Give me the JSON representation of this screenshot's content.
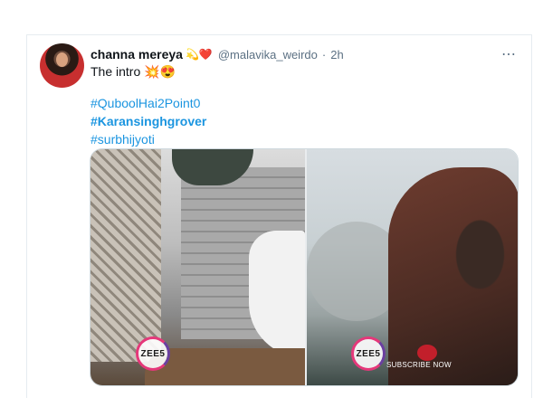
{
  "tweet": {
    "display_name": "channa mereya",
    "name_emojis": "💫❤️",
    "handle": "@malavika_weirdo",
    "separator": "·",
    "time": "2h",
    "more_icon": "⋯",
    "text": "The intro 💥😍",
    "hashtags": [
      "#QuboolHai2Point0",
      "#Karansinghgrover",
      "#surbhijyoti"
    ]
  },
  "media": {
    "left_logo_text": "ZEE5",
    "right_logo_text": "ZEE5",
    "subscribe_text": "SUBSCRIBE NOW"
  },
  "colors": {
    "link": "#1b95e0",
    "muted": "#5b7083",
    "border": "#e6ecf0"
  }
}
